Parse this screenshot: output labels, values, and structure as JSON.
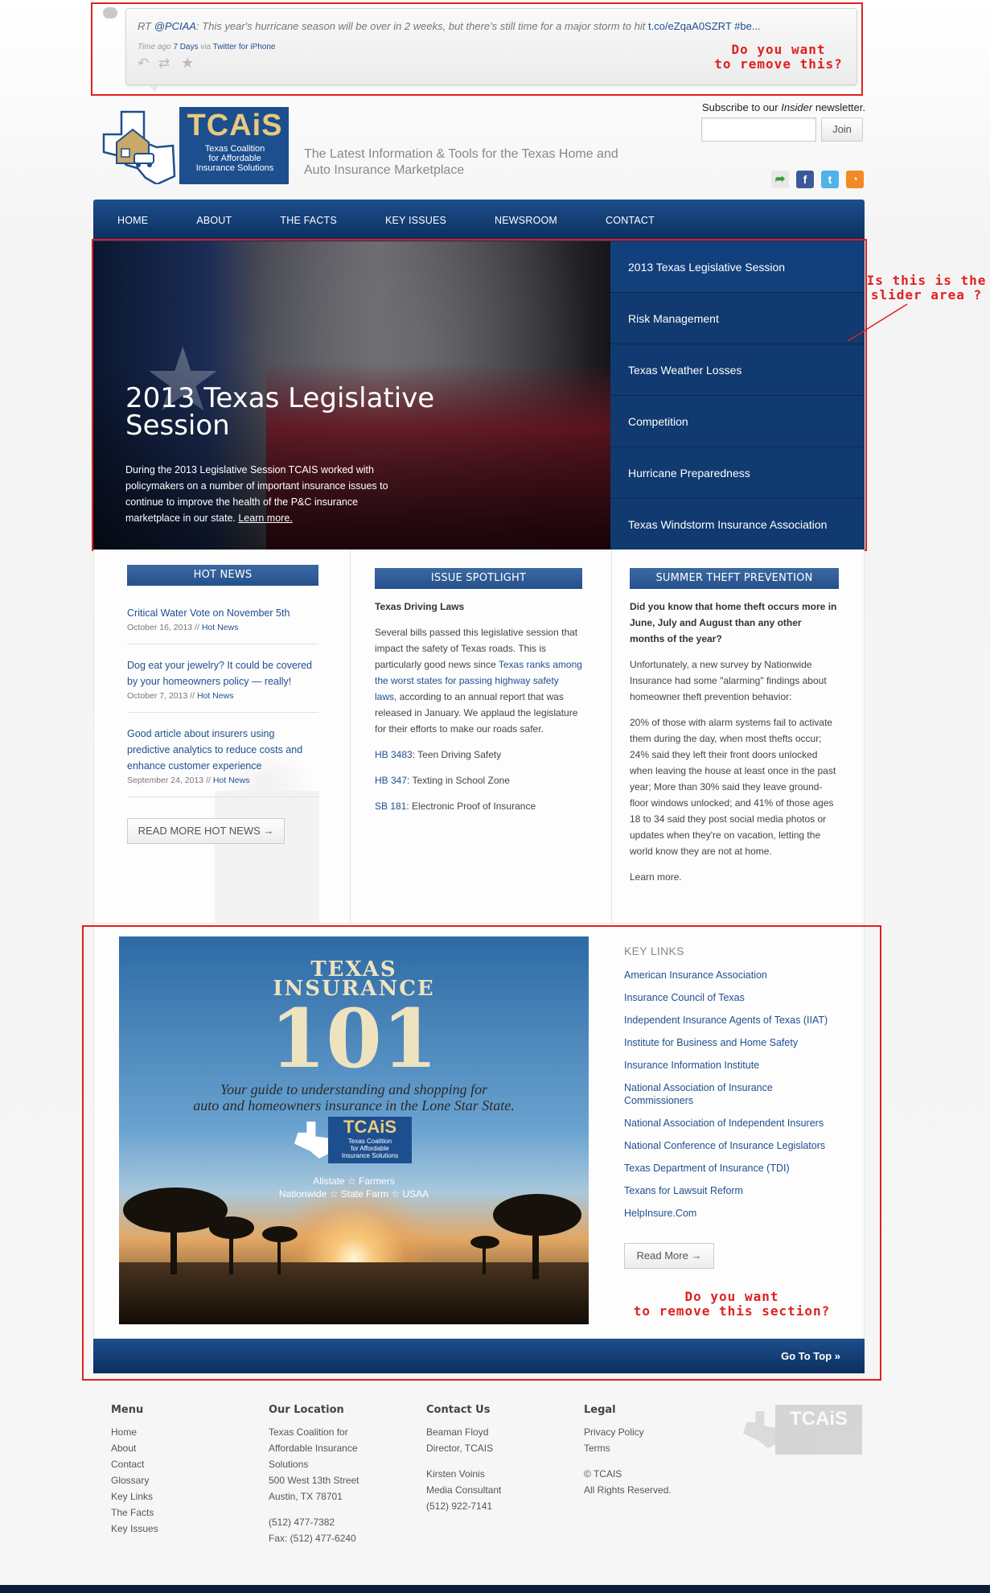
{
  "tweet": {
    "prefix": "RT ",
    "handle": "@PCIAA",
    "text": ": This year's hurricane season will be over in 2 weeks, but there's still time for a major storm to hit ",
    "link": "t.co/eZqaA0SZRT",
    "hashtag": " #be...",
    "time_prefix": "Time ago ",
    "time_value": "7 Days",
    "via": " via ",
    "client": "Twitter for iPhone"
  },
  "annotations": {
    "remove_tweet": "Do you want\nto remove this?",
    "slider_question": "Is this is the\nslider area ?",
    "remove_section": "Do you want\nto remove this section?"
  },
  "header": {
    "logo_text": "TCAiS",
    "logo_sub": "Texas Coalition\nfor Affordable\nInsurance Solutions",
    "tagline": "The Latest Information & Tools for the Texas Home and Auto Insurance Marketplace",
    "subscribe_pre": "Subscribe to our ",
    "subscribe_em": "Insider",
    "subscribe_post": " newsletter.",
    "join_label": "Join",
    "social": [
      "share-icon",
      "facebook-icon",
      "twitter-icon",
      "rss-icon"
    ]
  },
  "nav": [
    "HOME",
    "ABOUT",
    "THE FACTS",
    "KEY ISSUES",
    "NEWSROOM",
    "CONTACT"
  ],
  "slider": {
    "title": "2013 Texas Legislative Session",
    "description": "During the 2013 Legislative Session TCAIS worked with policymakers on a number of important insurance issues to continue to improve the health of the P&C insurance marketplace in our state. ",
    "more": "Learn more.",
    "items": [
      "2013 Texas Legislative Session",
      "Risk Management",
      "Texas Weather Losses",
      "Competition",
      "Hurricane Preparedness",
      "Texas Windstorm Insurance Association"
    ]
  },
  "hot_news": {
    "heading": "HOT NEWS",
    "items": [
      {
        "title": "Critical Water Vote on November 5th",
        "date": "October 16, 2013 // ",
        "cat": "Hot News"
      },
      {
        "title": "Dog eat your jewelry? It could be covered by your homeowners policy — really!",
        "date": "October 7, 2013 // ",
        "cat": "Hot News"
      },
      {
        "title": "Good article about insurers using predictive analytics to reduce costs and enhance customer experience",
        "date": "September 24, 2013 // ",
        "cat": "Hot News"
      }
    ],
    "read_more": "READ MORE HOT NEWS →"
  },
  "spotlight": {
    "heading": "ISSUE SPOTLIGHT",
    "subtitle": "Texas Driving Laws",
    "p1_a": "Several bills passed this legislative session that impact the safety of Texas roads. This is particularly good news since ",
    "p1_link": "Texas ranks among the worst states for passing highway safety laws",
    "p1_b": ", according to an annual report that was released in January. We applaud the legislature for their efforts to make our roads safer.",
    "bills": [
      {
        "id": "HB 3483",
        "desc": ": Teen Driving Safety"
      },
      {
        "id": "HB 347",
        "desc": ": Texting in School Zone"
      },
      {
        "id": "SB 181",
        "desc": ": Electronic Proof of Insurance"
      }
    ]
  },
  "theft": {
    "heading": "SUMMER THEFT PREVENTION",
    "lead": "Did you know that home theft occurs more in June, July and August than any other months of the year?",
    "p1": "Unfortunately, a new survey by Nationwide Insurance had some \"alarming\" findings about homeowner theft prevention behavior:",
    "p2": "20% of those with alarm systems fail to activate them during the day, when most thefts occur; 24% said they left their front doors unlocked when leaving the house at least once in the past year; More than 30% said they leave ground-floor windows unlocked; and 41% of those ages 18 to 34 said they post social media photos or updates when they're on vacation, letting the world know they are not at home.",
    "more": "Learn more."
  },
  "promo": {
    "line1": "TEXAS",
    "line2": "INSURANCE",
    "big": "101",
    "tag1": "Your guide to understanding and shopping for",
    "tag2": "auto and homeowners insurance in the Lone Star State.",
    "logo": "TCAiS",
    "logo_sub": "Texas Coalition\nfor Affordable\nInsurance Solutions",
    "members1": "Allstate ☆ Farmers",
    "members2": "Nationwide ☆ State Farm ☆ USAA"
  },
  "key_links": {
    "title": "KEY LINKS",
    "items": [
      "American Insurance Association",
      "Insurance Council of Texas",
      "Independent Insurance Agents of Texas (IIAT)",
      "Institute for Business and Home Safety",
      "Insurance Information Institute",
      "National Association of Insurance Commissioners",
      "National Association of Independent Insurers",
      "National Conference of Insurance Legislators",
      "Texas Department of Insurance (TDI)",
      "Texans for Lawsuit Reform",
      "HelpInsure.Com"
    ],
    "read_more": "Read More →"
  },
  "go_to_top": "Go To Top »",
  "footer": {
    "menu": {
      "heading": "Menu",
      "items": [
        "Home",
        "About",
        "Contact",
        "Glossary",
        "Key Links",
        "The Facts",
        "Key Issues"
      ]
    },
    "location": {
      "heading": "Our Location",
      "lines": [
        "Texas Coalition for",
        "Affordable Insurance",
        "Solutions",
        "500 West 13th Street",
        "Austin, TX 78701"
      ],
      "phone": "(512) 477-7382",
      "fax": "Fax: (512) 477-6240"
    },
    "contact": {
      "heading": "Contact Us",
      "name1": "Beaman Floyd",
      "role1": "Director, TCAIS",
      "name2": "Kirsten Voinis",
      "role2": "Media Consultant",
      "phone2": "(512) 922-7141"
    },
    "legal": {
      "heading": "Legal",
      "items": [
        "Privacy Policy",
        "Terms"
      ],
      "copy": "© TCAIS",
      "rights": "All Rights Reserved."
    },
    "logo": "TCAiS"
  }
}
